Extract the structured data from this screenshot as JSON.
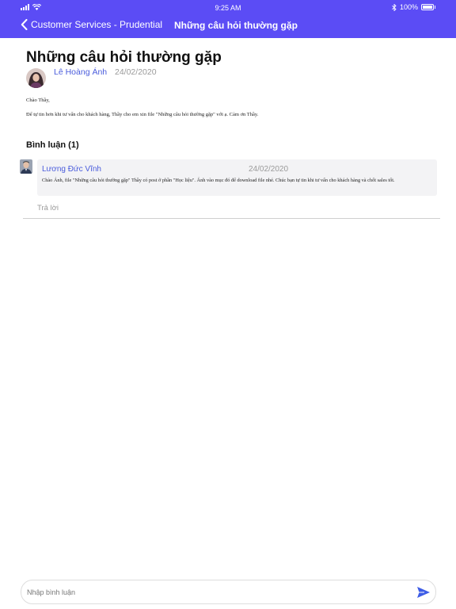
{
  "status_bar": {
    "time": "9:25 AM",
    "battery": "100%"
  },
  "nav": {
    "back_label": "Customer Services - Prudential",
    "title": "Những câu hỏi thường gặp"
  },
  "post": {
    "title": "Những câu hỏi thường gặp",
    "author": "Lê Hoàng Ánh",
    "date": "24/02/2020",
    "body": [
      "Chào Thầy,",
      "Để tự tin hơn khi tư vấn cho khách hàng, Thầy cho em xin file \"Những câu hỏi thường gặp\" với ạ. Cảm ơn Thầy."
    ]
  },
  "comments": {
    "heading": "Bình luận (1)",
    "items": [
      {
        "author": "Lương Đức Vĩnh",
        "date": "24/02/2020",
        "text": "Chào Ánh, file \"Những câu hỏi thường gặp\" Thầy có post ở phần \"Học liệu\". Ánh vào mục đó để download file nhé. Chúc bạn tự tin khi tư vấn cho khách hàng và chốt sales tốt."
      }
    ],
    "reply_label": "Trả lời"
  },
  "composer": {
    "placeholder": "Nhập bình luận"
  },
  "colors": {
    "header": "#5b4cf5",
    "link": "#4a5cdc",
    "send": "#3d5ce6"
  }
}
